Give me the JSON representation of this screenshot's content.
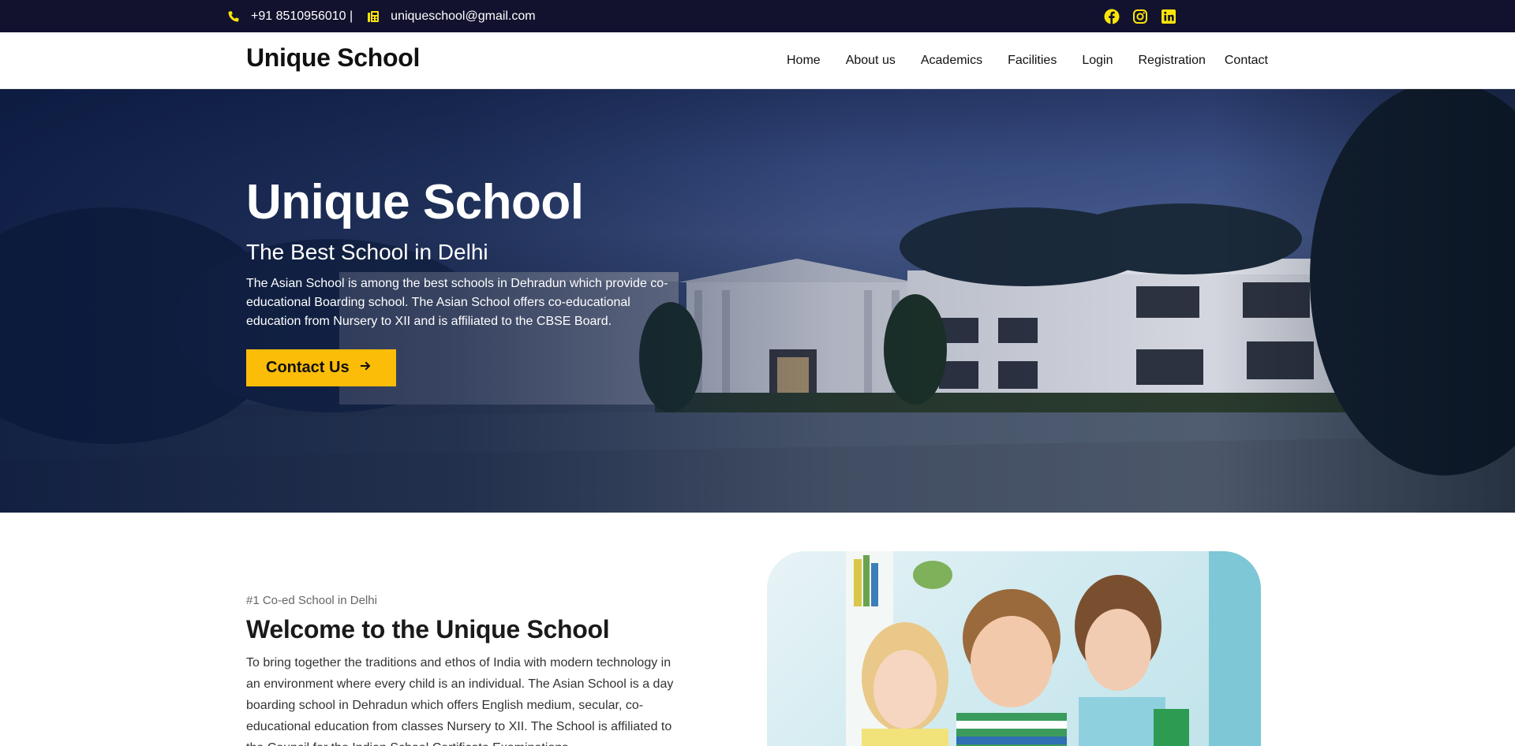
{
  "topbar": {
    "phone": "+91 8510956010 |",
    "email": "uniqueschool@gmail.com",
    "social_icons": [
      "facebook-icon",
      "instagram-icon",
      "linkedin-icon"
    ],
    "icon_color": "#fbe40a"
  },
  "brand": "Unique School",
  "nav": [
    "Home",
    "About us",
    "Academics",
    "Facilities",
    "Login",
    "Registration",
    "Contact"
  ],
  "hero": {
    "title": "Unique School",
    "subtitle": "The Best School in Delhi",
    "description": "The Asian School is among the best schools in Dehradun which provide co-educational Boarding school. The Asian School offers co-educational education from Nursery to XII and is affiliated to the CBSE Board.",
    "button_label": "Contact Us",
    "button_color": "#fbbd08"
  },
  "welcome": {
    "tag": "#1 Co-ed School in Delhi",
    "title": "Welcome to the Unique School",
    "text": "To bring together the traditions and ethos of India with modern technology in an environment where every child is an individual. The Asian School is a day boarding school in Dehradun which offers English medium, secular, co-educational education from classes Nursery to XII. The School is affiliated to the Council for the Indian School Certificate Examinations."
  },
  "colors": {
    "topbar_bg": "#12122e",
    "accent": "#fbbd08"
  }
}
